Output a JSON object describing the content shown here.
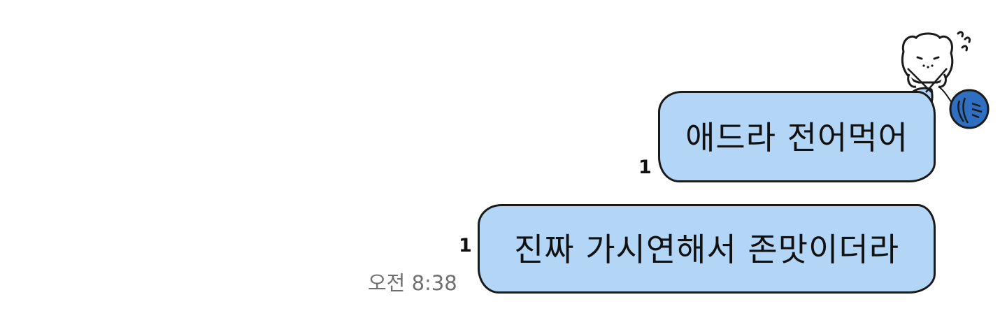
{
  "chat": {
    "messages": [
      {
        "text": "애드라 전어먹어",
        "unread_count": "1"
      },
      {
        "text": "진짜 가시연해서 존맛이더라",
        "unread_count": "1",
        "timestamp": "오전 8:38"
      }
    ],
    "sticker": {
      "icon": "knitting-bear-sticker-icon"
    }
  },
  "colors": {
    "bubble_fill": "#b3d6f7",
    "bubble_border": "#1a1a1a",
    "timestamp_text": "#6f6f6f",
    "yarn_ball": "#2f6fc2"
  }
}
